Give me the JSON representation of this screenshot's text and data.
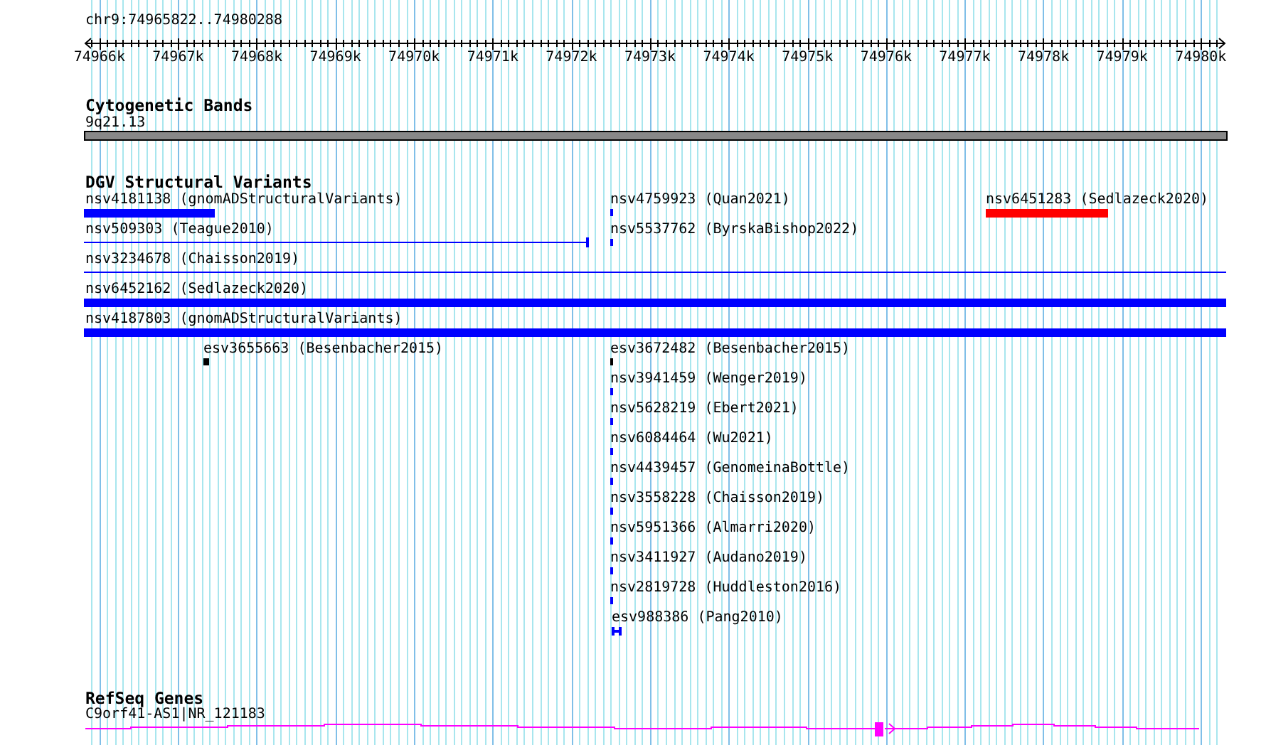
{
  "ruler": {
    "location": "chr9:74965822..74980288",
    "ticks": [
      "74966k",
      "74967k",
      "74968k",
      "74969k",
      "74970k",
      "74971k",
      "74972k",
      "74973k",
      "74974k",
      "74975k",
      "74976k",
      "74977k",
      "74978k",
      "74979k",
      "74980k"
    ]
  },
  "tracks": [
    {
      "kind": "bands",
      "title": "Cytogenetic Bands",
      "label": "9q21.13"
    },
    {
      "kind": "variants",
      "title": "DGV Structural Variants",
      "features": [
        {
          "label": "nsv4181138 (gnomADStructuralVariants)",
          "kind": "bar",
          "color": "#0000ff"
        },
        {
          "label": "nsv4759923 (Quan2021)",
          "kind": "bar",
          "color": "#0000ff"
        },
        {
          "label": "nsv6451283 (Sedlazeck2020)",
          "kind": "bar",
          "color": "#ff0000"
        },
        {
          "label": "nsv509303 (Teague2010)",
          "kind": "line",
          "color": "#0000ff"
        },
        {
          "label": "nsv5537762 (ByrskaBishop2022)",
          "kind": "bar",
          "color": "#0000ff"
        },
        {
          "label": "nsv3234678 (Chaisson2019)",
          "kind": "line",
          "color": "#0000ff"
        },
        {
          "label": "nsv6452162 (Sedlazeck2020)",
          "kind": "bar",
          "color": "#0000ff"
        },
        {
          "label": "nsv4187803 (gnomADStructuralVariants)",
          "kind": "bar",
          "color": "#0000ff"
        },
        {
          "label": "esv3655663 (Besenbacher2015)",
          "kind": "bar",
          "color": "#000000"
        },
        {
          "label": "esv3672482 (Besenbacher2015)",
          "kind": "bar",
          "color": "#000000"
        },
        {
          "label": "nsv3941459 (Wenger2019)",
          "kind": "bar",
          "color": "#0000ff"
        },
        {
          "label": "nsv5628219 (Ebert2021)",
          "kind": "bar",
          "color": "#0000ff"
        },
        {
          "label": "nsv6084464 (Wu2021)",
          "kind": "bar",
          "color": "#0000ff"
        },
        {
          "label": "nsv4439457 (GenomeinaBottle)",
          "kind": "bar",
          "color": "#0000ff"
        },
        {
          "label": "nsv3558228 (Chaisson2019)",
          "kind": "bar",
          "color": "#0000ff"
        },
        {
          "label": "nsv5951366 (Almarri2020)",
          "kind": "bar",
          "color": "#0000ff"
        },
        {
          "label": "nsv3411927 (Audano2019)",
          "kind": "bar",
          "color": "#0000ff"
        },
        {
          "label": "nsv2819728 (Huddleston2016)",
          "kind": "bar",
          "color": "#0000ff"
        },
        {
          "label": "esv988386 (Pang2010)",
          "kind": "bracket",
          "color": "#0000ff"
        }
      ]
    },
    {
      "kind": "genes",
      "title": "RefSeq Genes",
      "label": "C9orf41-AS1|NR_121183"
    }
  ]
}
